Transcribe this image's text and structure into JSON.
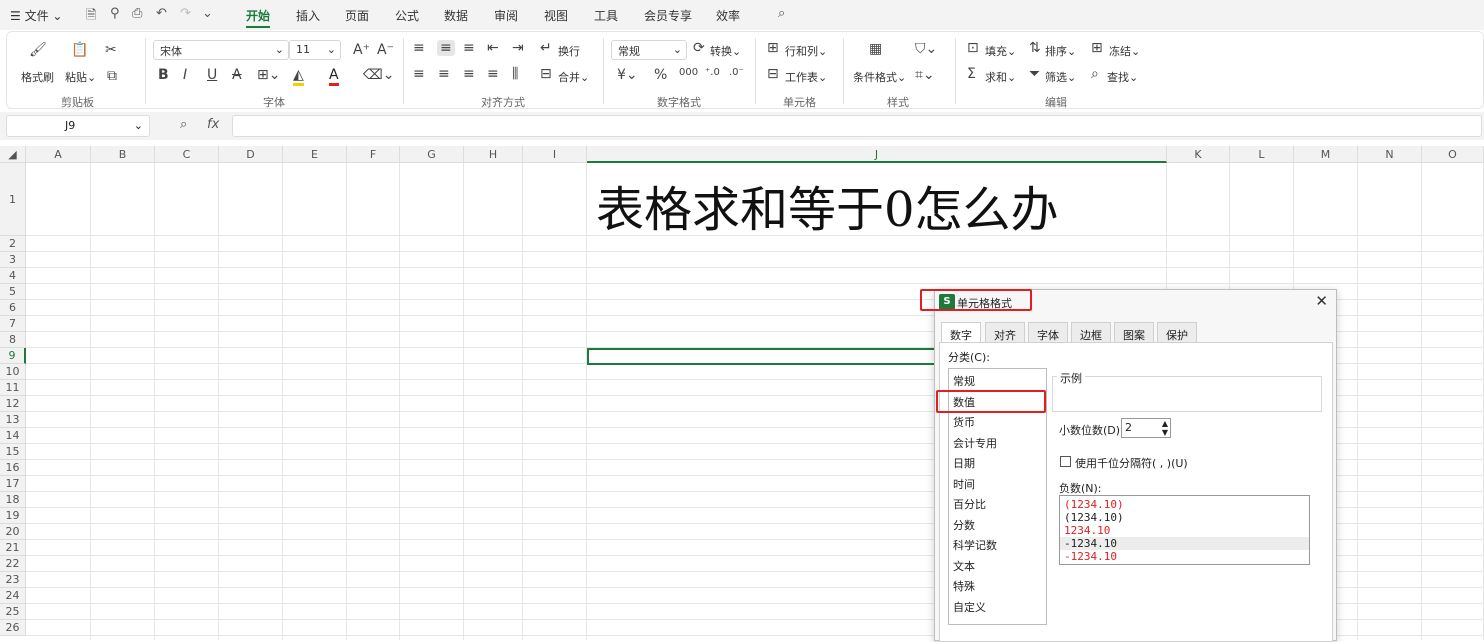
{
  "menubar": {
    "file": "文件",
    "tabs": [
      "开始",
      "插入",
      "页面",
      "公式",
      "数据",
      "审阅",
      "视图",
      "工具",
      "会员专享",
      "效率"
    ]
  },
  "ribbon": {
    "format_painter": "格式刷",
    "paste": "粘贴",
    "clipboard": "剪贴板",
    "font_name": "宋体",
    "font_size": "11",
    "font_group": "字体",
    "wrap": "换行",
    "merge": "合并",
    "align_group": "对齐方式",
    "number_format": "常规",
    "convert": "转换",
    "number_group": "数字格式",
    "rowcol": "行和列",
    "worksheet": "工作表",
    "cell_group": "单元格",
    "cond_format": "条件格式",
    "style_group": "样式",
    "fill": "填充",
    "sort": "排序",
    "freeze": "冻结",
    "sum": "求和",
    "filter": "筛选",
    "find": "查找",
    "edit_group": "编辑"
  },
  "namebox": "J9",
  "columns": [
    "A",
    "B",
    "C",
    "D",
    "E",
    "F",
    "G",
    "H",
    "I",
    "J",
    "K",
    "L",
    "M",
    "N",
    "O"
  ],
  "rows": [
    "1",
    "2",
    "3",
    "4",
    "5",
    "6",
    "7",
    "8",
    "9",
    "10",
    "11",
    "12",
    "13",
    "14",
    "15",
    "16",
    "17",
    "18",
    "19",
    "20",
    "21",
    "22",
    "23",
    "24",
    "25",
    "26"
  ],
  "title": "表格求和等于0怎么办",
  "dialog": {
    "title": "单元格格式",
    "tabs": [
      "数字",
      "对齐",
      "字体",
      "边框",
      "图案",
      "保护"
    ],
    "category_label": "分类(C):",
    "categories": [
      "常规",
      "数值",
      "货币",
      "会计专用",
      "日期",
      "时间",
      "百分比",
      "分数",
      "科学记数",
      "文本",
      "特殊",
      "自定义"
    ],
    "sample_label": "示例",
    "decimal_label": "小数位数(D):",
    "decimal_value": "2",
    "thousands_label": "使用千位分隔符( , )(U)",
    "negative_label": "负数(N):",
    "negatives": [
      "(1234.10)",
      "(1234.10)",
      "1234.10",
      "-1234.10",
      "-1234.10"
    ]
  },
  "colors": {
    "accent": "#1e7a3c",
    "highlight": "#e02020",
    "negative_red": "#e02020"
  }
}
